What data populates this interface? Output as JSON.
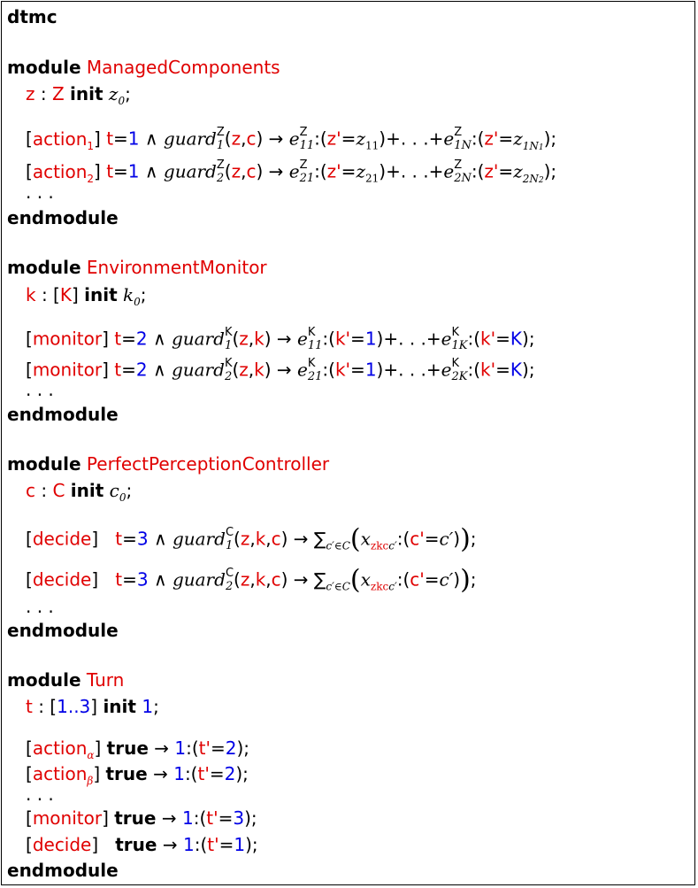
{
  "colors": {
    "keyword": "#000000",
    "identifier": "#e00000",
    "number": "#0000e6"
  },
  "header": {
    "model_type": "dtmc"
  },
  "keywords": {
    "module": "module",
    "endmodule": "endmodule",
    "init": "init",
    "true": "true"
  },
  "modules": [
    {
      "name": "ManagedComponents",
      "decl": {
        "var": "z",
        "type": "Z",
        "init_base": "z",
        "init_sub": "0"
      },
      "commands": [
        {
          "action": "action",
          "action_sub": "1",
          "guard_sub": "1",
          "prob1": "11",
          "val1_sub": "11",
          "probN": "1N",
          "probN_sub": "1",
          "valN": "1N",
          "valN_sub": "1"
        },
        {
          "action": "action",
          "action_sub": "2",
          "guard_sub": "2",
          "prob1": "21",
          "val1_sub": "21",
          "probN": "2N",
          "probN_sub": "2",
          "valN": "2N",
          "valN_sub": "2"
        }
      ],
      "turn_value": "1"
    },
    {
      "name": "EnvironmentMonitor",
      "decl": {
        "var": "k",
        "type": "K",
        "init_base": "k",
        "init_sub": "0"
      },
      "commands": [
        {
          "action": "monitor",
          "guard_sub": "1",
          "prob1": "11",
          "probK": "1K"
        },
        {
          "action": "monitor",
          "guard_sub": "2",
          "prob1": "21",
          "probK": "2K"
        }
      ],
      "turn_value": "2",
      "assign_value": "1",
      "assign_last": "K"
    },
    {
      "name": "PerfectPerceptionController",
      "decl": {
        "var": "c",
        "type": "C",
        "init_base": "c",
        "init_sub": "0"
      },
      "commands": [
        {
          "action": "decide",
          "guard_sub": "1"
        },
        {
          "action": "decide",
          "guard_sub": "2"
        }
      ],
      "turn_value": "3",
      "sum_sub": "c′∈C",
      "x_sub": "zkc",
      "x_sub_prime": "c′"
    },
    {
      "name": "Turn",
      "decl": {
        "var": "t",
        "range": "1..3",
        "init_value": "1"
      },
      "commands": [
        {
          "action": "action",
          "action_sub": "α",
          "prob": "1",
          "next": "2"
        },
        {
          "action": "action",
          "action_sub": "β",
          "prob": "1",
          "next": "2"
        },
        {
          "action": "monitor",
          "prob": "1",
          "next": "3"
        },
        {
          "action": "decide",
          "prob": "1",
          "next": "1"
        }
      ]
    }
  ]
}
